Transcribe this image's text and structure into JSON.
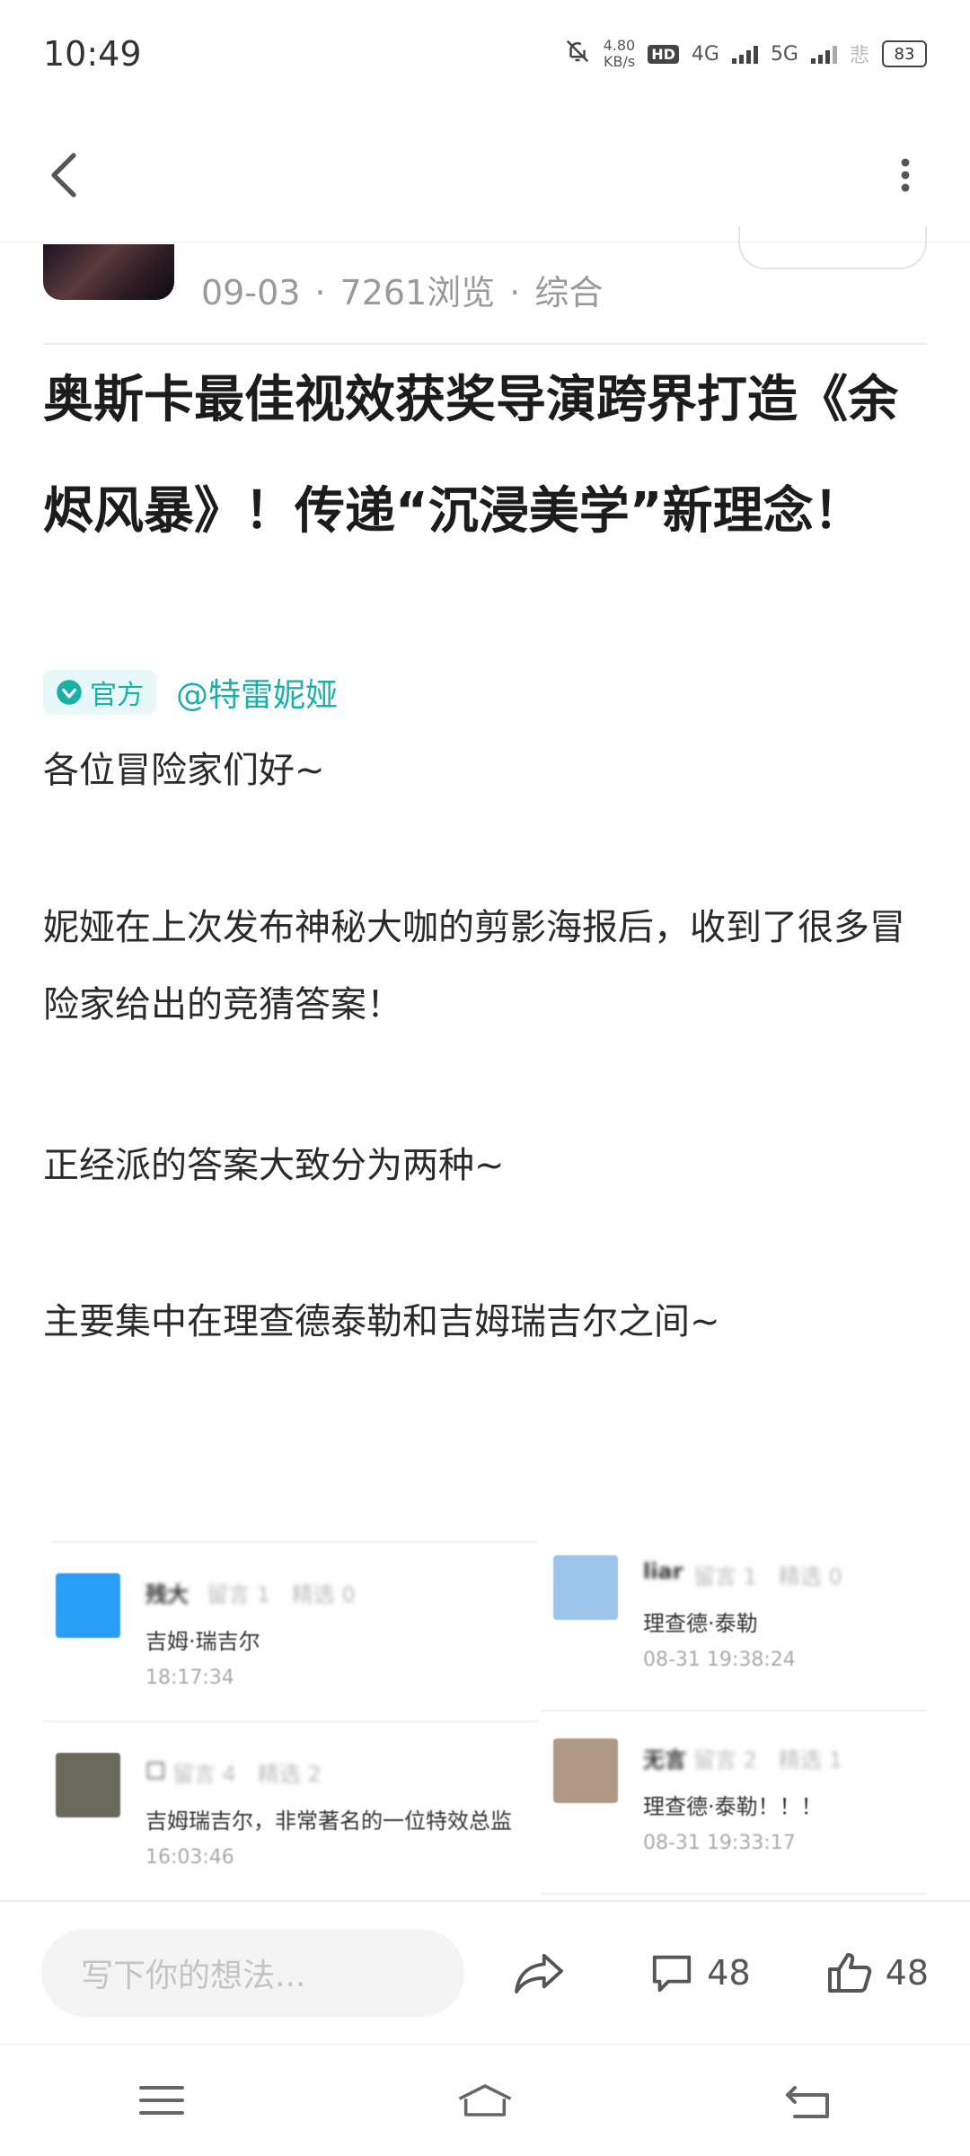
{
  "status_bar": {
    "time": "10:49",
    "net_speed_value": "4.80",
    "net_speed_unit": "KB/s",
    "hd_label": "HD",
    "network_1": "4G",
    "network_2": "5G",
    "carrier_hint": "悲",
    "battery": "83"
  },
  "nav": {
    "back_icon": "chevron-left-icon",
    "more_icon": "more-vertical-icon"
  },
  "post_meta": {
    "date": "09-03",
    "views": "7261浏览",
    "category": "综合",
    "separator": "·"
  },
  "article": {
    "title": "奥斯卡最佳视效获奖导演跨界打造《余烬风暴》！传递“沉浸美学”新理念！",
    "official_badge": "官方",
    "author": "@特雷妮娅",
    "paragraphs": [
      "各位冒险家们好~",
      "妮娅在上次发布神秘大咖的剪影海报后，收到了很多冒险家给出的竞猜答案！",
      "正经派的答案大致分为两种~",
      "主要集中在理查德泰勒和吉姆瑞吉尔之间~"
    ]
  },
  "embedded_comments": [
    {
      "name": "残大",
      "stats": "留言 1　精选 0",
      "content": "吉姆·瑞吉尔",
      "time": "18:17:34",
      "avatar_color": "#2a9df4"
    },
    {
      "name": "□",
      "stats": "留言 4　精选 2",
      "content": "吉姆瑞吉尔，非常著名的一位特效总监",
      "time": "16:03:46",
      "avatar_color": "#6b6a5a"
    },
    {
      "name": "liar",
      "stats": "留言 1　精选 0",
      "content": "理查德·泰勒",
      "time": "08-31 19:38:24",
      "avatar_color": "#9cc3e8"
    },
    {
      "name": "无言",
      "stats": "留言 2　精选 1",
      "content": "理查德·泰勒！！！",
      "time": "08-31 19:33:17",
      "avatar_color": "#b09a86"
    }
  ],
  "bottom_bar": {
    "input_placeholder": "写下你的想法...",
    "comment_count": "48",
    "like_count": "48"
  }
}
